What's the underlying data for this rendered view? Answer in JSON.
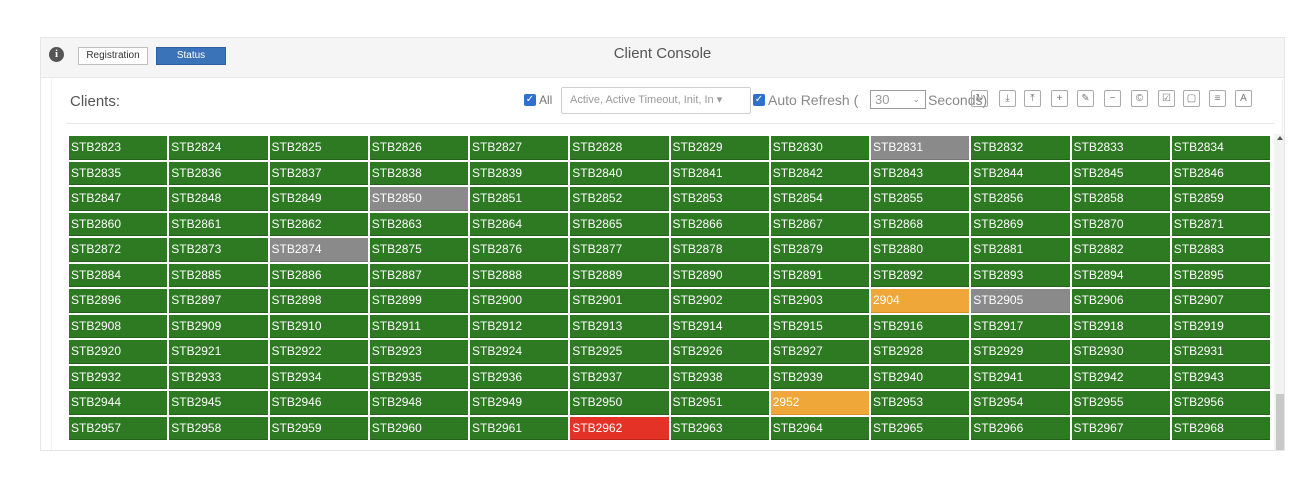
{
  "header": {
    "registration_label": "Registration",
    "status_label": "Status",
    "title": "Client Console"
  },
  "toolbar": {
    "clients_label": "Clients:",
    "all_label": "All",
    "filter_value": "Active, Active Timeout, Init, In ▾",
    "auto_refresh_label": "Auto Refresh (",
    "seconds_value": "30",
    "seconds_label": "Seconds)",
    "icons": [
      "refresh-icon",
      "download-icon",
      "upload-icon",
      "add-icon",
      "edit-icon",
      "remove-icon",
      "copyright-icon",
      "check-icon",
      "stop-icon",
      "list-icon",
      "text-icon"
    ],
    "icon_glyphs": [
      "↻",
      "⤓",
      "⤒",
      "+",
      "✎",
      "−",
      "©",
      "☑",
      "▢",
      "≡",
      "A"
    ]
  },
  "clients": [
    [
      [
        "STB2823",
        "ok"
      ],
      [
        "STB2824",
        "ok"
      ],
      [
        "STB2825",
        "ok"
      ],
      [
        "STB2826",
        "ok"
      ],
      [
        "STB2827",
        "ok"
      ],
      [
        "STB2828",
        "ok"
      ],
      [
        "STB2829",
        "ok"
      ],
      [
        "STB2830",
        "ok"
      ],
      [
        "STB2831",
        "offline"
      ],
      [
        "STB2832",
        "ok"
      ],
      [
        "STB2833",
        "ok"
      ],
      [
        "STB2834",
        "ok"
      ]
    ],
    [
      [
        "STB2835",
        "ok"
      ],
      [
        "STB2836",
        "ok"
      ],
      [
        "STB2837",
        "ok"
      ],
      [
        "STB2838",
        "ok"
      ],
      [
        "STB2839",
        "ok"
      ],
      [
        "STB2840",
        "ok"
      ],
      [
        "STB2841",
        "ok"
      ],
      [
        "STB2842",
        "ok"
      ],
      [
        "STB2843",
        "ok"
      ],
      [
        "STB2844",
        "ok"
      ],
      [
        "STB2845",
        "ok"
      ],
      [
        "STB2846",
        "ok"
      ]
    ],
    [
      [
        "STB2847",
        "ok"
      ],
      [
        "STB2848",
        "ok"
      ],
      [
        "STB2849",
        "ok"
      ],
      [
        "STB2850",
        "offline"
      ],
      [
        "STB2851",
        "ok"
      ],
      [
        "STB2852",
        "ok"
      ],
      [
        "STB2853",
        "ok"
      ],
      [
        "STB2854",
        "ok"
      ],
      [
        "STB2855",
        "ok"
      ],
      [
        "STB2856",
        "ok"
      ],
      [
        "STB2858",
        "ok"
      ],
      [
        "STB2859",
        "ok"
      ]
    ],
    [
      [
        "STB2860",
        "ok"
      ],
      [
        "STB2861",
        "ok"
      ],
      [
        "STB2862",
        "ok"
      ],
      [
        "STB2863",
        "ok"
      ],
      [
        "STB2864",
        "ok"
      ],
      [
        "STB2865",
        "ok"
      ],
      [
        "STB2866",
        "ok"
      ],
      [
        "STB2867",
        "ok"
      ],
      [
        "STB2868",
        "ok"
      ],
      [
        "STB2869",
        "ok"
      ],
      [
        "STB2870",
        "ok"
      ],
      [
        "STB2871",
        "ok"
      ]
    ],
    [
      [
        "STB2872",
        "ok"
      ],
      [
        "STB2873",
        "ok"
      ],
      [
        "STB2874",
        "offline"
      ],
      [
        "STB2875",
        "ok"
      ],
      [
        "STB2876",
        "ok"
      ],
      [
        "STB2877",
        "ok"
      ],
      [
        "STB2878",
        "ok"
      ],
      [
        "STB2879",
        "ok"
      ],
      [
        "STB2880",
        "ok"
      ],
      [
        "STB2881",
        "ok"
      ],
      [
        "STB2882",
        "ok"
      ],
      [
        "STB2883",
        "ok"
      ]
    ],
    [
      [
        "STB2884",
        "ok"
      ],
      [
        "STB2885",
        "ok"
      ],
      [
        "STB2886",
        "ok"
      ],
      [
        "STB2887",
        "ok"
      ],
      [
        "STB2888",
        "ok"
      ],
      [
        "STB2889",
        "ok"
      ],
      [
        "STB2890",
        "ok"
      ],
      [
        "STB2891",
        "ok"
      ],
      [
        "STB2892",
        "ok"
      ],
      [
        "STB2893",
        "ok"
      ],
      [
        "STB2894",
        "ok"
      ],
      [
        "STB2895",
        "ok"
      ]
    ],
    [
      [
        "STB2896",
        "ok"
      ],
      [
        "STB2897",
        "ok"
      ],
      [
        "STB2898",
        "ok"
      ],
      [
        "STB2899",
        "ok"
      ],
      [
        "STB2900",
        "ok"
      ],
      [
        "STB2901",
        "ok"
      ],
      [
        "STB2902",
        "ok"
      ],
      [
        "STB2903",
        "ok"
      ],
      [
        "2904",
        "warn"
      ],
      [
        "STB2905",
        "offline"
      ],
      [
        "STB2906",
        "ok"
      ],
      [
        "STB2907",
        "ok"
      ]
    ],
    [
      [
        "STB2908",
        "ok"
      ],
      [
        "STB2909",
        "ok"
      ],
      [
        "STB2910",
        "ok"
      ],
      [
        "STB2911",
        "ok"
      ],
      [
        "STB2912",
        "ok"
      ],
      [
        "STB2913",
        "ok"
      ],
      [
        "STB2914",
        "ok"
      ],
      [
        "STB2915",
        "ok"
      ],
      [
        "STB2916",
        "ok"
      ],
      [
        "STB2917",
        "ok"
      ],
      [
        "STB2918",
        "ok"
      ],
      [
        "STB2919",
        "ok"
      ]
    ],
    [
      [
        "STB2920",
        "ok"
      ],
      [
        "STB2921",
        "ok"
      ],
      [
        "STB2922",
        "ok"
      ],
      [
        "STB2923",
        "ok"
      ],
      [
        "STB2924",
        "ok"
      ],
      [
        "STB2925",
        "ok"
      ],
      [
        "STB2926",
        "ok"
      ],
      [
        "STB2927",
        "ok"
      ],
      [
        "STB2928",
        "ok"
      ],
      [
        "STB2929",
        "ok"
      ],
      [
        "STB2930",
        "ok"
      ],
      [
        "STB2931",
        "ok"
      ]
    ],
    [
      [
        "STB2932",
        "ok"
      ],
      [
        "STB2933",
        "ok"
      ],
      [
        "STB2934",
        "ok"
      ],
      [
        "STB2935",
        "ok"
      ],
      [
        "STB2936",
        "ok"
      ],
      [
        "STB2937",
        "ok"
      ],
      [
        "STB2938",
        "ok"
      ],
      [
        "STB2939",
        "ok"
      ],
      [
        "STB2940",
        "ok"
      ],
      [
        "STB2941",
        "ok"
      ],
      [
        "STB2942",
        "ok"
      ],
      [
        "STB2943",
        "ok"
      ]
    ],
    [
      [
        "STB2944",
        "ok"
      ],
      [
        "STB2945",
        "ok"
      ],
      [
        "STB2946",
        "ok"
      ],
      [
        "STB2948",
        "ok"
      ],
      [
        "STB2949",
        "ok"
      ],
      [
        "STB2950",
        "ok"
      ],
      [
        "STB2951",
        "ok"
      ],
      [
        "2952",
        "warn"
      ],
      [
        "STB2953",
        "ok"
      ],
      [
        "STB2954",
        "ok"
      ],
      [
        "STB2955",
        "ok"
      ],
      [
        "STB2956",
        "ok"
      ]
    ],
    [
      [
        "STB2957",
        "ok"
      ],
      [
        "STB2958",
        "ok"
      ],
      [
        "STB2959",
        "ok"
      ],
      [
        "STB2960",
        "ok"
      ],
      [
        "STB2961",
        "ok"
      ],
      [
        "STB2962",
        "error"
      ],
      [
        "STB2963",
        "ok"
      ],
      [
        "STB2964",
        "ok"
      ],
      [
        "STB2965",
        "ok"
      ],
      [
        "STB2966",
        "ok"
      ],
      [
        "STB2967",
        "ok"
      ],
      [
        "STB2968",
        "ok"
      ]
    ]
  ],
  "status_colors": {
    "ok": "#2e7a23",
    "offline": "#8a8a8a",
    "warn": "#f0a73a",
    "error": "#e43226"
  }
}
